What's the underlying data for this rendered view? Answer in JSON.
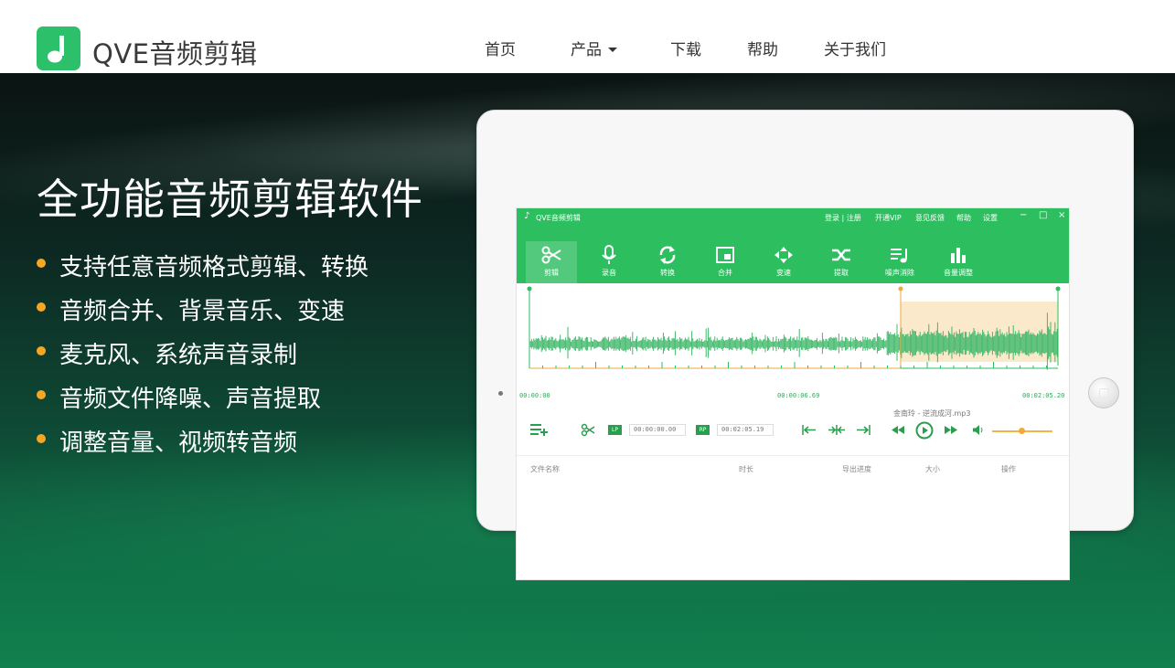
{
  "brand": {
    "name": "QVE音频剪辑",
    "logo_icon": "music-note-icon",
    "color": "#2cc06a"
  },
  "nav": [
    {
      "label": "首页"
    },
    {
      "label": "产品",
      "has_dropdown": true
    },
    {
      "label": "下载"
    },
    {
      "label": "帮助"
    },
    {
      "label": "关于我们"
    }
  ],
  "hero": {
    "title": "全功能音频剪辑软件",
    "features": [
      "支持任意音频格式剪辑、转换",
      "音频合并、背景音乐、变速",
      "麦克风、系统声音录制",
      "音频文件降噪、声音提取",
      "调整音量、视频转音频"
    ],
    "bullet_color": "#f5a623"
  },
  "app": {
    "title": "QVE音频剪辑",
    "menu": [
      "登录 | 注册",
      "开通VIP",
      "意见反馈",
      "帮助",
      "设置"
    ],
    "window_controls": [
      "−",
      "□",
      "×"
    ],
    "tools": [
      {
        "label": "剪辑",
        "icon": "scissors-icon",
        "active": true
      },
      {
        "label": "录音",
        "icon": "microphone-icon"
      },
      {
        "label": "转换",
        "icon": "convert-icon"
      },
      {
        "label": "合并",
        "icon": "merge-icon"
      },
      {
        "label": "变速",
        "icon": "speed-icon"
      },
      {
        "label": "提取",
        "icon": "extract-icon"
      },
      {
        "label": "噪声消除",
        "icon": "noise-removal-icon"
      },
      {
        "label": "音量调整",
        "icon": "volume-adjust-icon"
      }
    ],
    "timeline": {
      "start": "00:00:00",
      "mid": "00:00:06.69",
      "end": "00:02:05.20"
    },
    "file_name": "金南玲 - 逆流成河.mp3",
    "start_marker_label": "LP",
    "end_marker_label": "RP",
    "start_time": "00:00:00.00",
    "end_time": "00:02:05.19",
    "table_headers": [
      "文件名称",
      "时长",
      "导出进度",
      "大小",
      "操作"
    ],
    "accent": "#2dbe60",
    "selection_color": "#fbe9cc"
  }
}
